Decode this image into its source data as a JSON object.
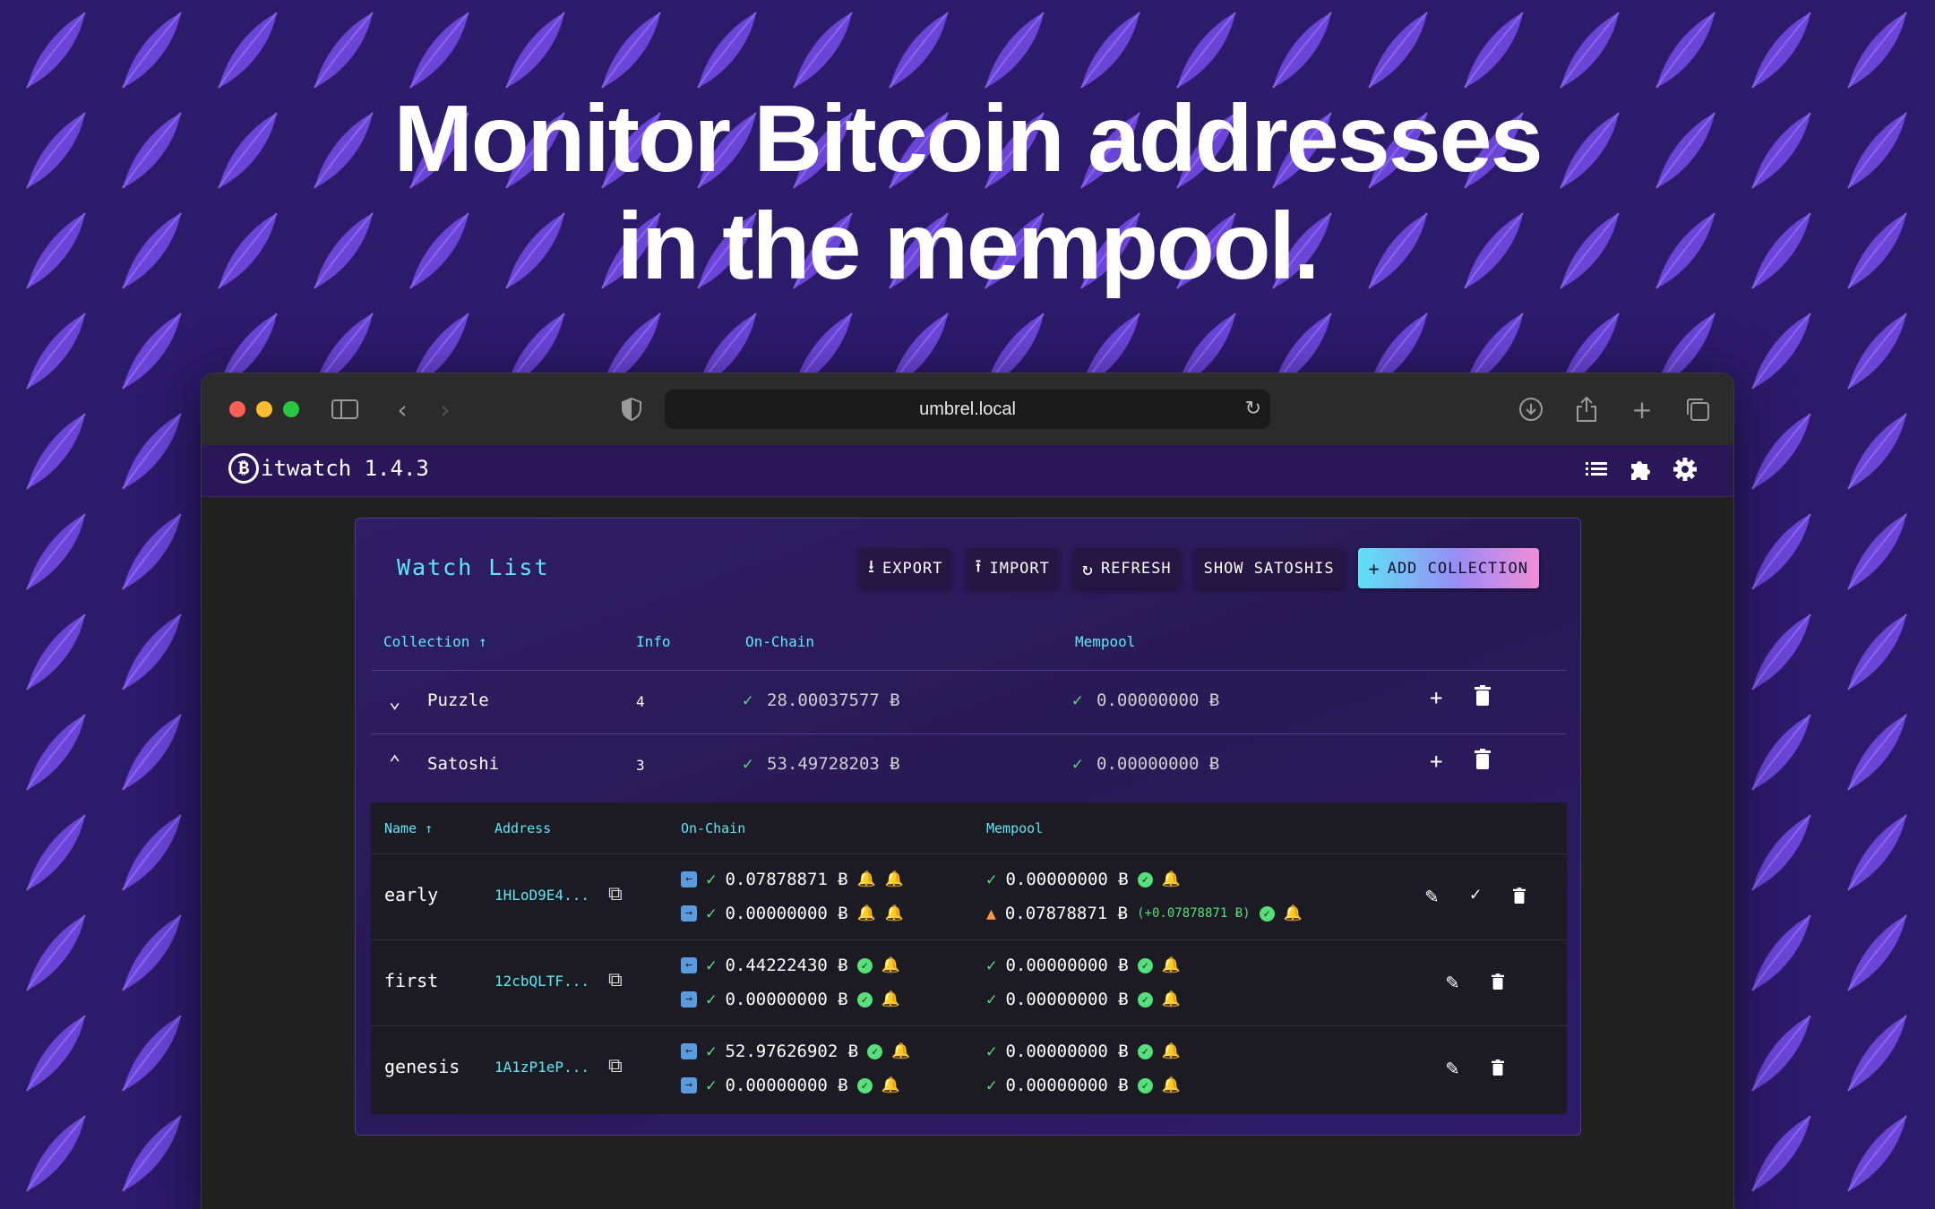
{
  "hero": {
    "line1": "Monitor Bitcoin addresses",
    "line2": "in the mempool."
  },
  "browser": {
    "url": "umbrel.local"
  },
  "app": {
    "title": "itwatch 1.4.3",
    "logo_letter": "₿"
  },
  "watchlist": {
    "title": "Watch List",
    "buttons": {
      "export": "EXPORT",
      "import": "IMPORT",
      "refresh": "REFRESH",
      "show_satoshis": "SHOW SATOSHIS",
      "add_collection": "ADD COLLECTION"
    },
    "headers": {
      "collection": "Collection ↑",
      "info": "Info",
      "onchain": "On-Chain",
      "mempool": "Mempool"
    },
    "collections": [
      {
        "name": "Puzzle",
        "info": "4",
        "onchain": "28.00037577 Ƀ",
        "mempool": "0.00000000 Ƀ",
        "expanded": false
      },
      {
        "name": "Satoshi",
        "info": "3",
        "onchain": "53.49728203 Ƀ",
        "mempool": "0.00000000 Ƀ",
        "expanded": true
      }
    ],
    "sub_headers": {
      "name": "Name ↑",
      "address": "Address",
      "onchain": "On-Chain",
      "mempool": "Mempool"
    },
    "addresses": [
      {
        "name": "early",
        "address": "1HLoD9E4...",
        "onchain_in": "0.07878871 Ƀ",
        "onchain_out": "0.00000000 Ƀ",
        "mempool_in": "0.00000000 Ƀ",
        "mempool_out": "0.07878871 Ƀ",
        "mempool_delta": "(+0.07878871 Ƀ)"
      },
      {
        "name": "first",
        "address": "12cbQLTF...",
        "onchain_in": "0.44222430 Ƀ",
        "onchain_out": "0.00000000 Ƀ",
        "mempool_in": "0.00000000 Ƀ",
        "mempool_out": "0.00000000 Ƀ"
      },
      {
        "name": "genesis",
        "address": "1A1zP1eP...",
        "onchain_in": "52.97626902 Ƀ",
        "onchain_out": "0.00000000 Ƀ",
        "mempool_in": "0.00000000 Ƀ",
        "mempool_out": "0.00000000 Ƀ"
      }
    ]
  },
  "colors": {
    "accent": "#5ee8f5",
    "ok": "#57e07a",
    "bell": "#ff9a3c",
    "background": "#2c1a6b"
  }
}
